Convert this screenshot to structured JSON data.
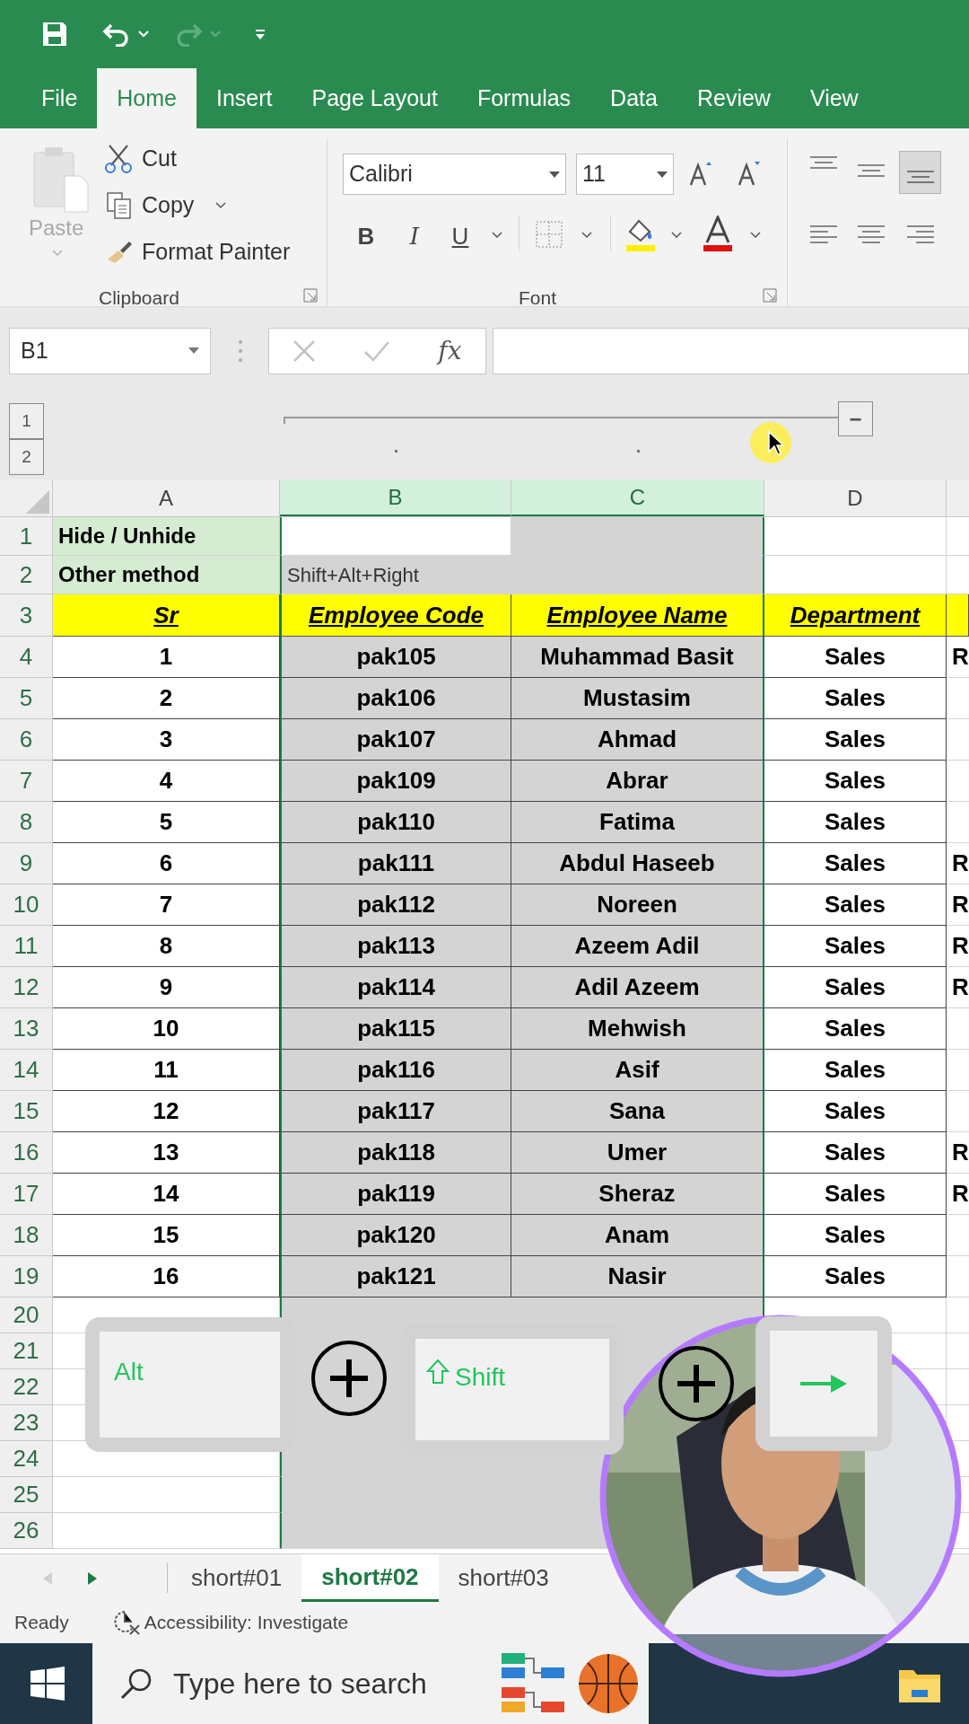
{
  "ribbon_tabs": [
    {
      "label": "File",
      "selected": false
    },
    {
      "label": "Home",
      "selected": true
    },
    {
      "label": "Insert",
      "selected": false
    },
    {
      "label": "Page Layout",
      "selected": false
    },
    {
      "label": "Formulas",
      "selected": false
    },
    {
      "label": "Data",
      "selected": false
    },
    {
      "label": "Review",
      "selected": false
    },
    {
      "label": "View",
      "selected": false
    }
  ],
  "clipboard": {
    "paste": "Paste",
    "cut": "Cut",
    "copy": "Copy",
    "format_painter": "Format Painter",
    "group_label": "Clipboard"
  },
  "font": {
    "name": "Calibri",
    "size": "11",
    "bold": "B",
    "italic": "I",
    "underline": "U",
    "group_label": "Font"
  },
  "formula_bar": {
    "name_box": "B1",
    "fx": "fx"
  },
  "outline": {
    "levels": [
      "1",
      "2"
    ],
    "collapse": "−"
  },
  "columns": [
    {
      "label": "A",
      "selected": false
    },
    {
      "label": "B",
      "selected": true
    },
    {
      "label": "C",
      "selected": true
    },
    {
      "label": "D",
      "selected": false
    }
  ],
  "rows": [
    {
      "number": "1",
      "kind": "note",
      "active": true,
      "a": "Hide / Unhide"
    },
    {
      "number": "2",
      "kind": "note",
      "a": "Other method",
      "b": "Shift+Alt+Right"
    },
    {
      "number": "3",
      "kind": "header",
      "a": "Sr",
      "b": "Employee Code",
      "c": "Employee Name",
      "d": "Department"
    },
    {
      "number": "4",
      "kind": "data",
      "a": "1",
      "b": "pak105",
      "c": "Muhammad Basit",
      "d": "Sales",
      "e": "R"
    },
    {
      "number": "5",
      "kind": "data",
      "a": "2",
      "b": "pak106",
      "c": "Mustasim",
      "d": "Sales"
    },
    {
      "number": "6",
      "kind": "data",
      "a": "3",
      "b": "pak107",
      "c": "Ahmad",
      "d": "Sales"
    },
    {
      "number": "7",
      "kind": "data",
      "a": "4",
      "b": "pak109",
      "c": "Abrar",
      "d": "Sales"
    },
    {
      "number": "8",
      "kind": "data",
      "a": "5",
      "b": "pak110",
      "c": "Fatima",
      "d": "Sales"
    },
    {
      "number": "9",
      "kind": "data",
      "a": "6",
      "b": "pak111",
      "c": "Abdul Haseeb",
      "d": "Sales",
      "e": "R"
    },
    {
      "number": "10",
      "kind": "data",
      "a": "7",
      "b": "pak112",
      "c": "Noreen",
      "d": "Sales",
      "e": "R"
    },
    {
      "number": "11",
      "kind": "data",
      "a": "8",
      "b": "pak113",
      "c": "Azeem Adil",
      "d": "Sales",
      "e": "R"
    },
    {
      "number": "12",
      "kind": "data",
      "a": "9",
      "b": "pak114",
      "c": "Adil Azeem",
      "d": "Sales",
      "e": "R"
    },
    {
      "number": "13",
      "kind": "data",
      "a": "10",
      "b": "pak115",
      "c": "Mehwish",
      "d": "Sales"
    },
    {
      "number": "14",
      "kind": "data",
      "a": "11",
      "b": "pak116",
      "c": "Asif",
      "d": "Sales"
    },
    {
      "number": "15",
      "kind": "data",
      "a": "12",
      "b": "pak117",
      "c": "Sana",
      "d": "Sales"
    },
    {
      "number": "16",
      "kind": "data",
      "a": "13",
      "b": "pak118",
      "c": "Umer",
      "d": "Sales",
      "e": "R"
    },
    {
      "number": "17",
      "kind": "data",
      "a": "14",
      "b": "pak119",
      "c": "Sheraz",
      "d": "Sales",
      "e": "R"
    },
    {
      "number": "18",
      "kind": "data",
      "a": "15",
      "b": "pak120",
      "c": "Anam",
      "d": "Sales"
    },
    {
      "number": "19",
      "kind": "data",
      "a": "16",
      "b": "pak121",
      "c": "Nasir",
      "d": "Sales"
    },
    {
      "number": "20",
      "kind": "blank"
    },
    {
      "number": "21",
      "kind": "blank"
    },
    {
      "number": "22",
      "kind": "blank"
    },
    {
      "number": "23",
      "kind": "blank"
    },
    {
      "number": "24",
      "kind": "blank"
    },
    {
      "number": "25",
      "kind": "blank"
    },
    {
      "number": "26",
      "kind": "blank"
    }
  ],
  "sheet_tabs": [
    {
      "label": "short#01",
      "selected": false
    },
    {
      "label": "short#02",
      "selected": true
    },
    {
      "label": "short#03",
      "selected": false
    }
  ],
  "status_bar": {
    "ready": "Ready",
    "accessibility": "Accessibility: Investigate"
  },
  "taskbar": {
    "search_placeholder": "Type here to search"
  },
  "key_overlay": [
    {
      "kind": "text",
      "label": "Alt"
    },
    {
      "kind": "shift",
      "label": "Shift"
    },
    {
      "kind": "arrow"
    }
  ]
}
